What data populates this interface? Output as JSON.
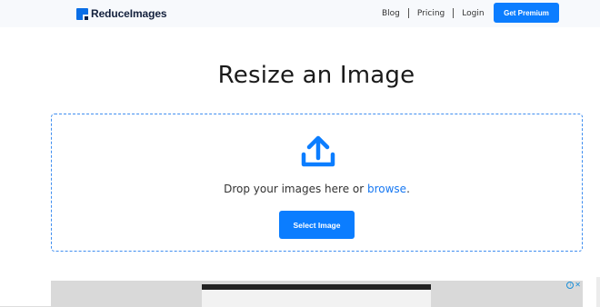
{
  "header": {
    "logo_text": "ReduceImages",
    "nav": [
      {
        "label": "Blog"
      },
      {
        "label": "Pricing"
      },
      {
        "label": "Login"
      }
    ],
    "premium_label": "Get Premium"
  },
  "main": {
    "title": "Resize an Image",
    "dropzone": {
      "text_prefix": "Drop your images here or ",
      "browse_link": "browse",
      "text_suffix": ".",
      "button_label": "Select Image",
      "icon": "upload-icon"
    }
  },
  "ad": {
    "info_glyph": "i",
    "close_glyph": "✕"
  },
  "colors": {
    "accent": "#0b7dff",
    "link": "#1778f2",
    "dropzone_border": "#3f8ef0",
    "header_bg": "#f7f9fc"
  }
}
